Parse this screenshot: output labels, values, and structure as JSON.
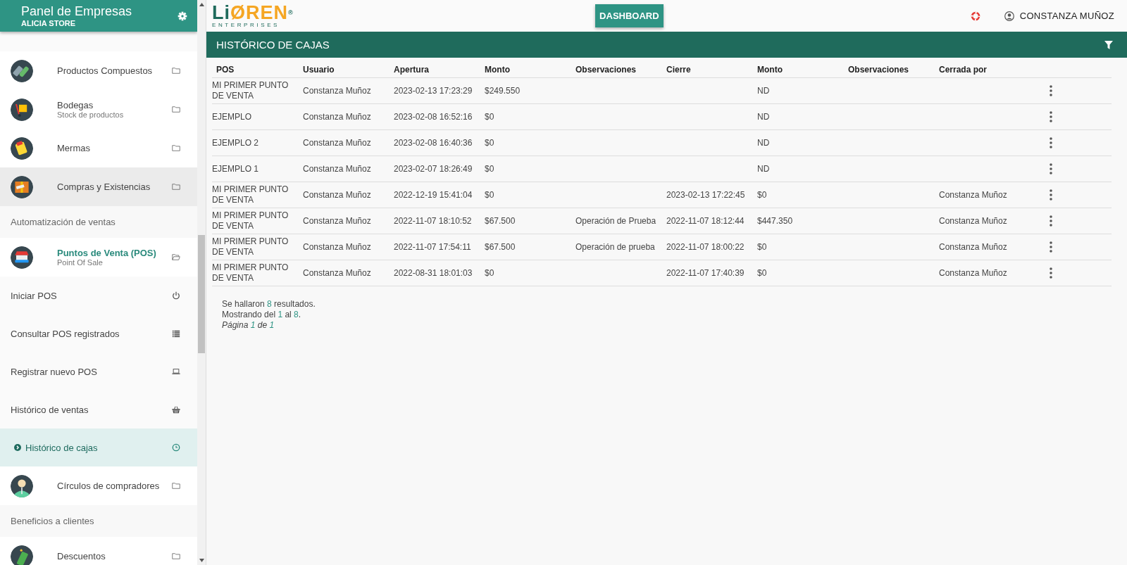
{
  "sidebar": {
    "title": "Panel de Empresas",
    "subtitle": "ALICIA STORE",
    "items": [
      {
        "kind": "module",
        "label": "Productos Compuestos",
        "hovered": false,
        "expanded": false
      },
      {
        "kind": "module",
        "label": "Bodegas",
        "sublabel": "Stock de productos",
        "hovered": false,
        "expanded": false
      },
      {
        "kind": "module",
        "label": "Mermas",
        "hovered": false,
        "expanded": false
      },
      {
        "kind": "module",
        "label": "Compras y Existencias",
        "hovered": true,
        "expanded": false
      },
      {
        "kind": "section",
        "label": "Automatización de ventas"
      },
      {
        "kind": "module",
        "label": "Puntos de Venta (POS)",
        "sublabel": "Point Of Sale",
        "hovered": false,
        "expanded": true
      },
      {
        "kind": "subitem",
        "label": "Iniciar POS",
        "selected": false
      },
      {
        "kind": "subitem",
        "label": "Consultar POS registrados",
        "selected": false
      },
      {
        "kind": "subitem",
        "label": "Registrar nuevo POS",
        "selected": false
      },
      {
        "kind": "subitem",
        "label": "Histórico de ventas",
        "selected": false
      },
      {
        "kind": "subitem",
        "label": "Histórico de cajas",
        "selected": true
      },
      {
        "kind": "module",
        "label": "Círculos de compradores",
        "hovered": false,
        "expanded": false
      },
      {
        "kind": "section",
        "label": "Beneficios a clientes"
      },
      {
        "kind": "module",
        "label": "Descuentos",
        "hovered": false,
        "expanded": false
      }
    ]
  },
  "topbar": {
    "logo": "LiØREN",
    "logo_mark": "®",
    "logo_tagline": "ENTERPRISES",
    "dashboard_button": "DASHBOARD",
    "user": "CONSTANZA MUÑOZ"
  },
  "panel": {
    "title": "HISTÓRICO DE CAJAS"
  },
  "table": {
    "columns": [
      "POS",
      "Usuario",
      "Apertura",
      "Monto",
      "Observaciones",
      "Cierre",
      "Monto",
      "Observaciones",
      "Cerrada por"
    ],
    "rows": [
      [
        "MI PRIMER PUNTO DE VENTA",
        "Constanza Muñoz",
        "2023-02-13 17:23:29",
        "$249.550",
        "",
        "",
        "ND",
        "",
        ""
      ],
      [
        "EJEMPLO",
        "Constanza Muñoz",
        "2023-02-08 16:52:16",
        "$0",
        "",
        "",
        "ND",
        "",
        ""
      ],
      [
        "EJEMPLO 2",
        "Constanza Muñoz",
        "2023-02-08 16:40:36",
        "$0",
        "",
        "",
        "ND",
        "",
        ""
      ],
      [
        "EJEMPLO 1",
        "Constanza Muñoz",
        "2023-02-07 18:26:49",
        "$0",
        "",
        "",
        "ND",
        "",
        ""
      ],
      [
        "MI PRIMER PUNTO DE VENTA",
        "Constanza Muñoz",
        "2022-12-19 15:41:04",
        "$0",
        "",
        "2023-02-13 17:22:45",
        "$0",
        "",
        "Constanza Muñoz"
      ],
      [
        "MI PRIMER PUNTO DE VENTA",
        "Constanza Muñoz",
        "2022-11-07 18:10:52",
        "$67.500",
        "Operación de Prueba",
        "2022-11-07 18:12:44",
        "$447.350",
        "",
        "Constanza Muñoz"
      ],
      [
        "MI PRIMER PUNTO DE VENTA",
        "Constanza Muñoz",
        "2022-11-07 17:54:11",
        "$67.500",
        "Operación de prueba",
        "2022-11-07 18:00:22",
        "$0",
        "",
        "Constanza Muñoz"
      ],
      [
        "MI PRIMER PUNTO DE VENTA",
        "Constanza Muñoz",
        "2022-08-31 18:01:03",
        "$0",
        "",
        "2022-11-07 17:40:39",
        "$0",
        "",
        "Constanza Muñoz"
      ]
    ]
  },
  "summary": [
    {
      "italic": false,
      "parts": [
        {
          "text": "Se hallaron ",
          "highlight": false
        },
        {
          "text": "8",
          "highlight": true
        },
        {
          "text": " resultados.",
          "highlight": false
        }
      ]
    },
    {
      "italic": false,
      "parts": [
        {
          "text": "Mostrando del ",
          "highlight": false
        },
        {
          "text": "1",
          "highlight": true
        },
        {
          "text": " al ",
          "highlight": false
        },
        {
          "text": "8",
          "highlight": true
        },
        {
          "text": ".",
          "highlight": false
        }
      ]
    },
    {
      "italic": true,
      "parts": [
        {
          "text": "Página ",
          "highlight": false
        },
        {
          "text": "1",
          "highlight": true
        },
        {
          "text": " de ",
          "highlight": false
        },
        {
          "text": "1",
          "highlight": true
        }
      ]
    }
  ]
}
